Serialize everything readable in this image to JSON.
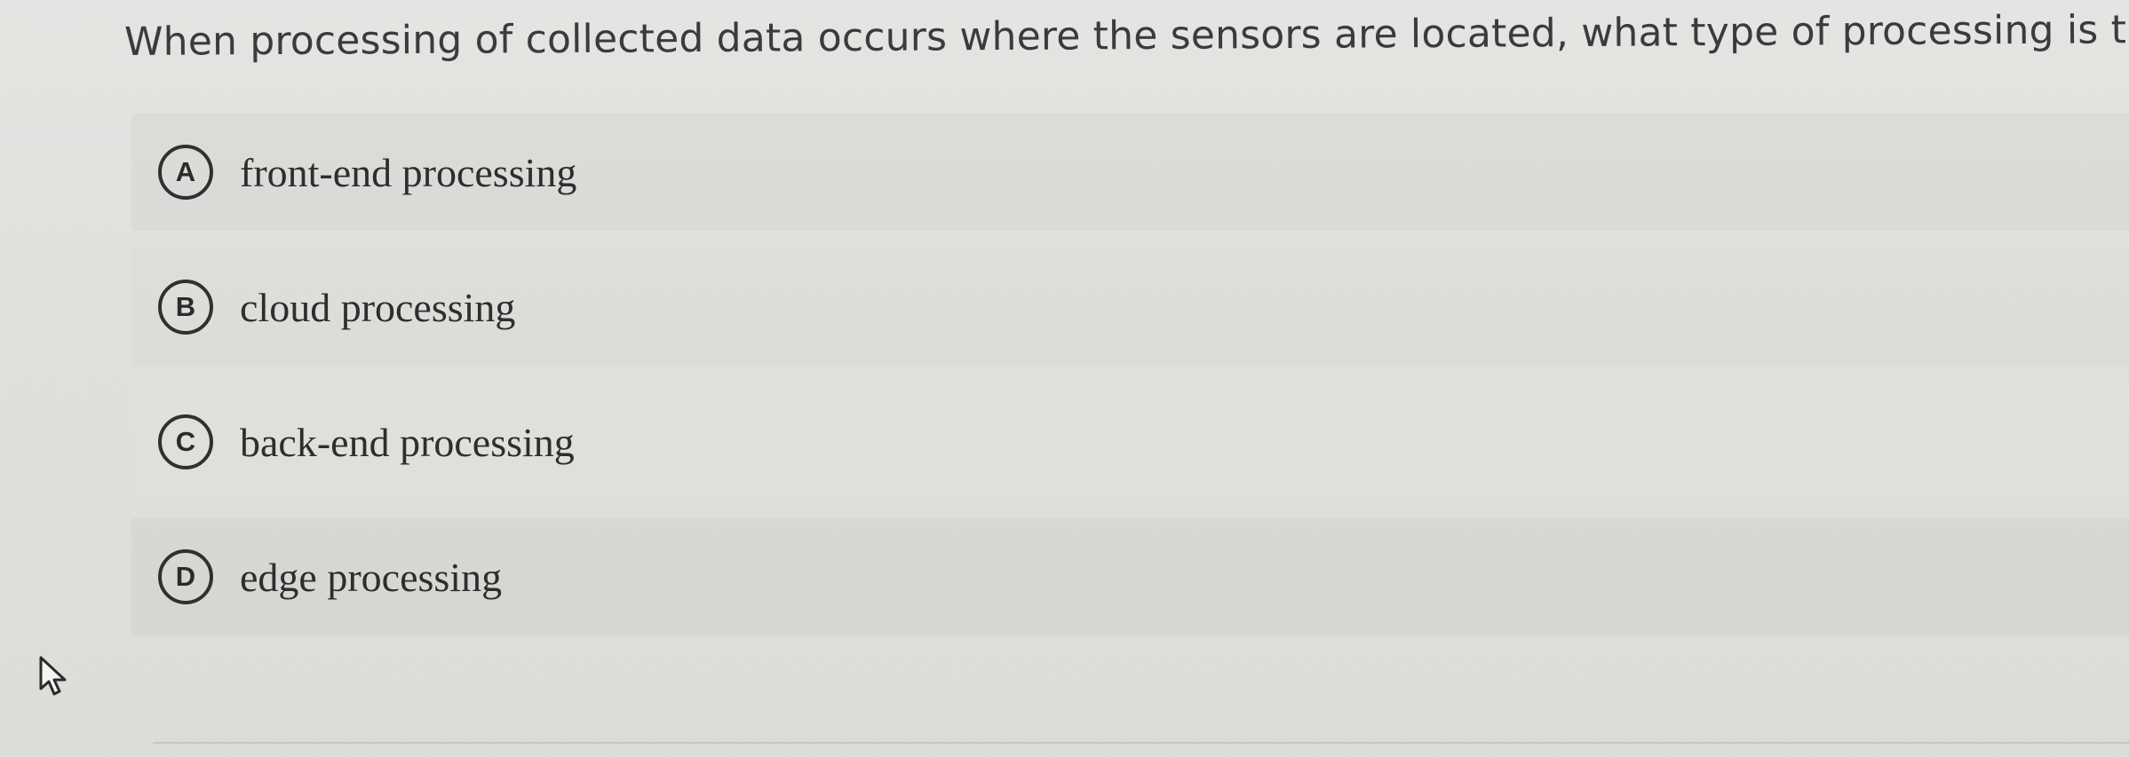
{
  "question": {
    "text": "When processing of collected data occurs where the sensors are located, what type of processing is this?"
  },
  "options": [
    {
      "letter": "A",
      "label": "front-end processing"
    },
    {
      "letter": "B",
      "label": "cloud processing"
    },
    {
      "letter": "C",
      "label": "back-end processing"
    },
    {
      "letter": "D",
      "label": "edge processing"
    }
  ],
  "icons": {
    "cursor": "mouse-pointer-icon"
  },
  "colors": {
    "background": "#dfe0dc",
    "text": "#2e2f2f"
  }
}
